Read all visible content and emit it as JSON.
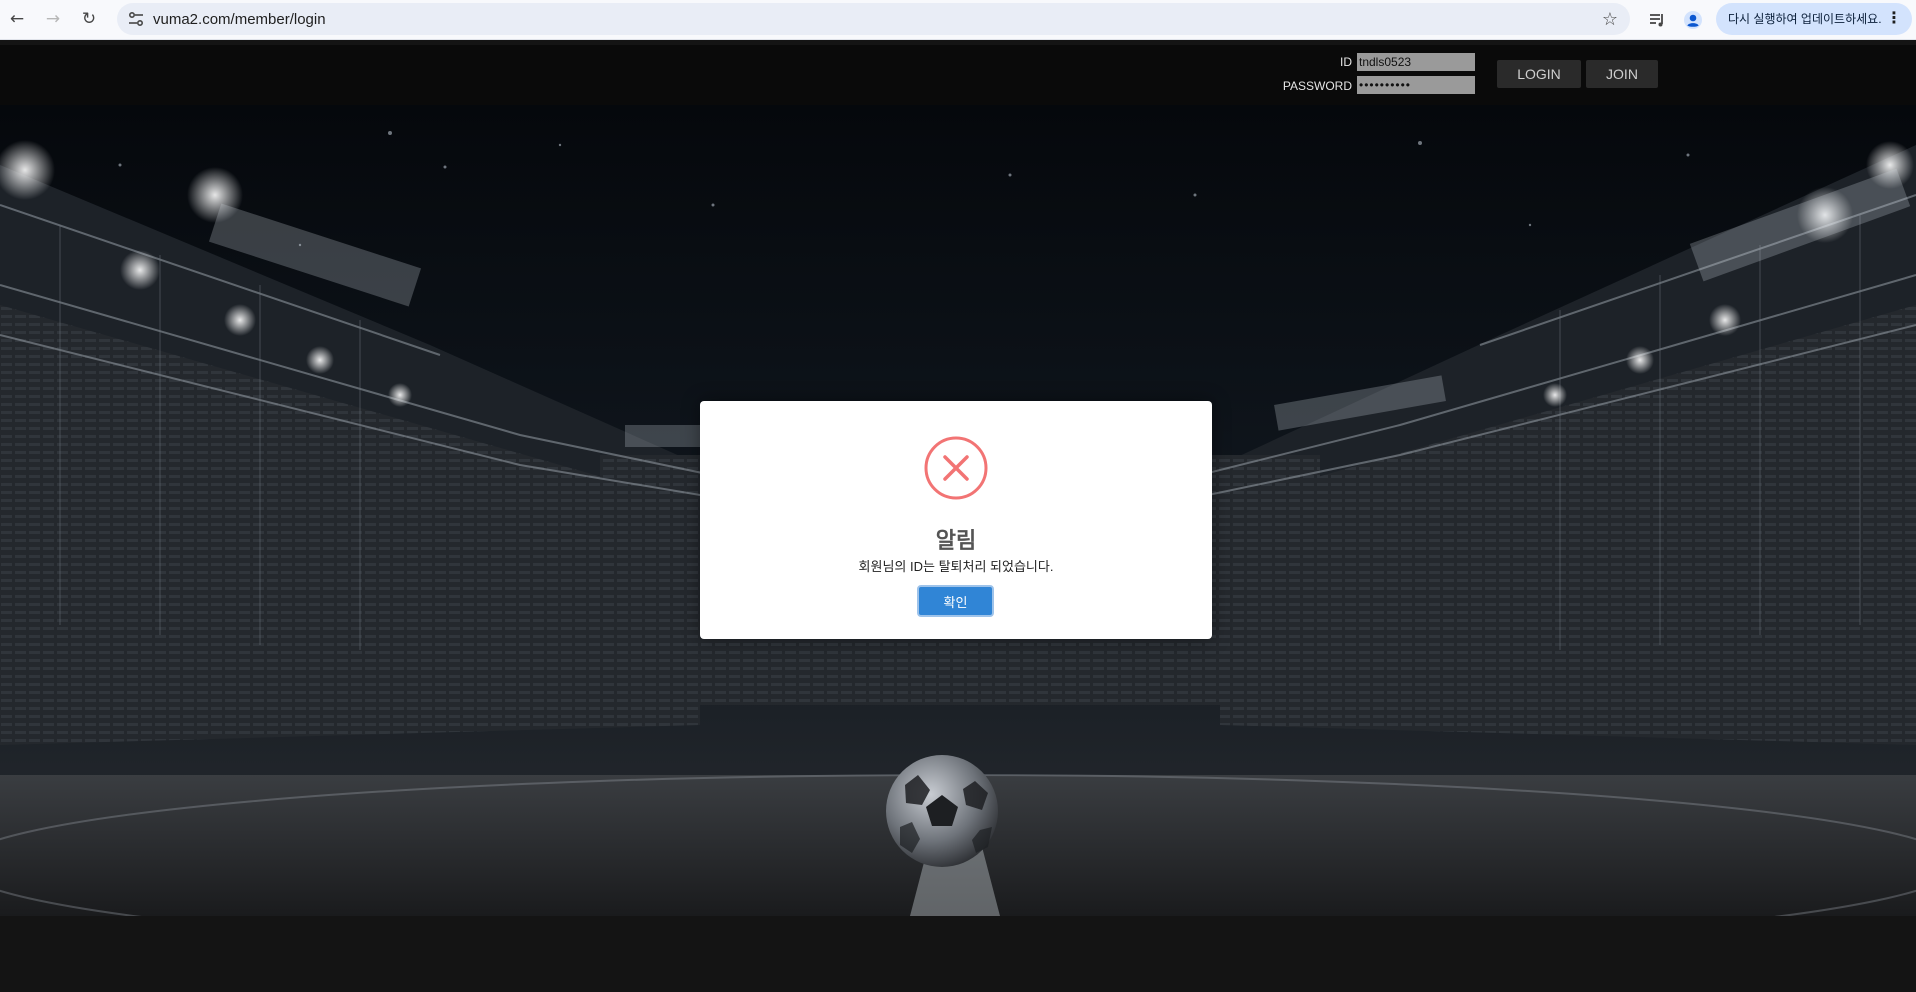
{
  "browser": {
    "url": "vuma2.com/member/login",
    "update_text": "다시 실행하여 업데이트하세요.",
    "icons": [
      "back-arrow-icon",
      "forward-arrow-icon",
      "reload-icon",
      "site-info-icon",
      "bookmark-star-icon",
      "media-control-icon",
      "profile-icon",
      "menu-dots-icon"
    ]
  },
  "header": {
    "id_label": "ID",
    "id_value": "tndls0523",
    "password_label": "PASSWORD",
    "password_value": "••••••••••",
    "login_label": "LOGIN",
    "join_label": "JOIN"
  },
  "modal": {
    "title": "알림",
    "message": "회원님의 ID는 탈퇴처리 되었습니다.",
    "confirm_label": "확인",
    "icon": "error-x-icon"
  },
  "colors": {
    "error_red": "#f27474",
    "confirm_blue": "#3085d6",
    "header_bg": "#0a0a0a",
    "update_pill": "#d3e3fd"
  }
}
